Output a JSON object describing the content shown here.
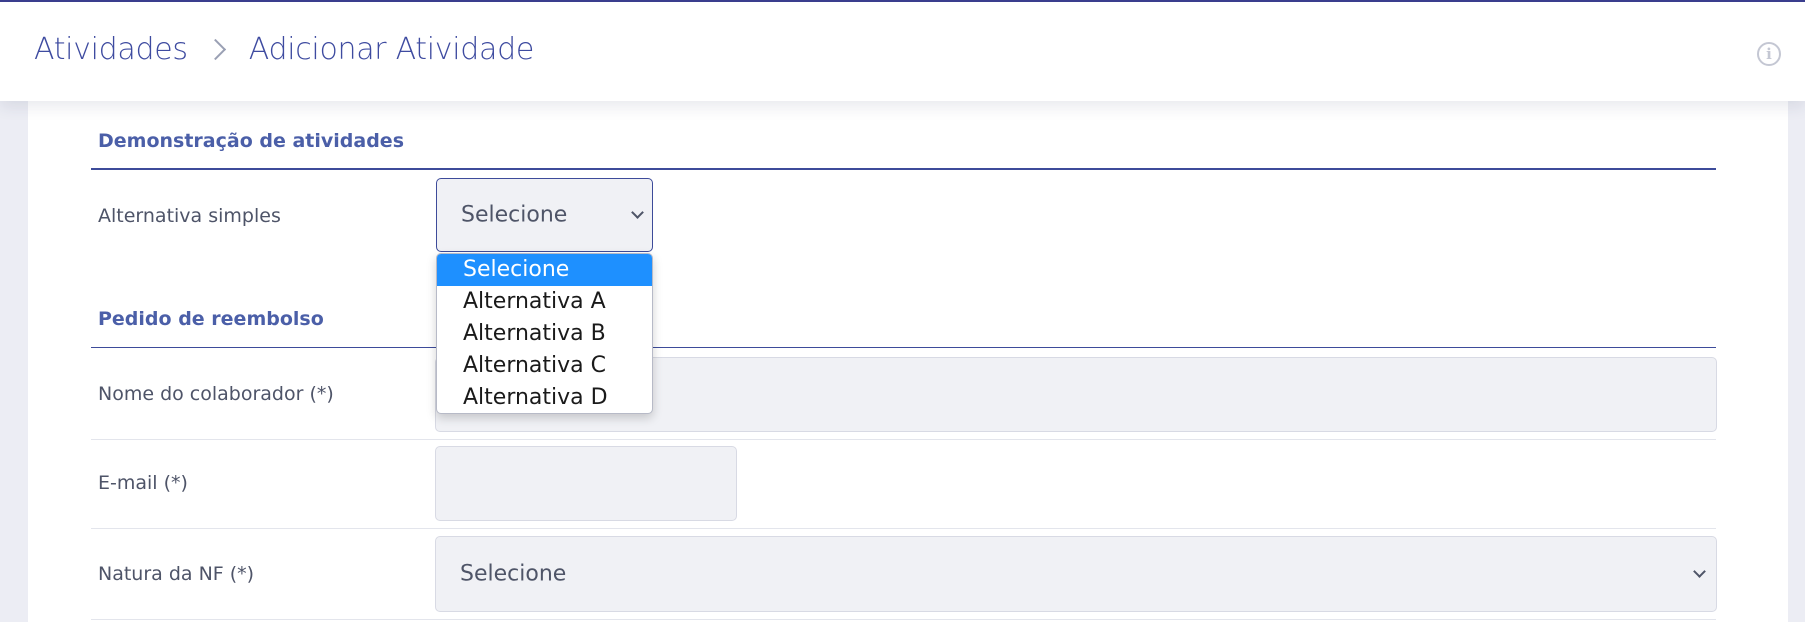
{
  "breadcrumb": {
    "parent": "Atividades",
    "current": "Adicionar Atividade"
  },
  "info_icon": "info-icon",
  "sections": {
    "demo": {
      "title": "Demonstração de atividades",
      "alternativa_label": "Alternativa simples",
      "alternativa_value": "Selecione",
      "alternativa_options": [
        "Selecione",
        "Alternativa A",
        "Alternativa B",
        "Alternativa C",
        "Alternativa D"
      ],
      "alternativa_selected_index": 0
    },
    "reembolso": {
      "title": "Pedido de reembolso",
      "nome_label": "Nome do colaborador (*)",
      "nome_value": "",
      "email_label": "E-mail (*)",
      "email_value": "",
      "natura_label": "Natura da NF (*)",
      "natura_value": "Selecione"
    }
  },
  "colors": {
    "accent": "#3e4ba0",
    "section_title": "#4b5fa8",
    "option_highlight": "#1e90ff",
    "field_bg": "#f0f1f5"
  }
}
